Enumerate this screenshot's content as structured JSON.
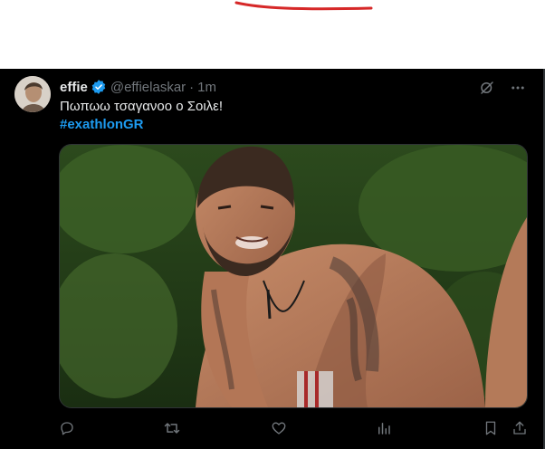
{
  "tweet": {
    "display_name": "effie",
    "handle": "@effielaskar",
    "separator": "·",
    "timestamp": "1m",
    "text": "Πωπωω τσαγανοο ο Σοιλε!",
    "hashtag": "#exathlonGR",
    "verified": true
  },
  "icons": {
    "verified": "verified-badge-icon",
    "grok": "grok-icon",
    "more": "more-dots-icon",
    "reply": "reply-icon",
    "retweet": "retweet-icon",
    "like": "like-icon",
    "views": "views-icon",
    "bookmark": "bookmark-icon",
    "share": "share-icon"
  },
  "colors": {
    "background": "#000000",
    "text": "#e7e9ea",
    "muted": "#71767b",
    "accent": "#1d9bf0",
    "annotation": "#d62828"
  }
}
